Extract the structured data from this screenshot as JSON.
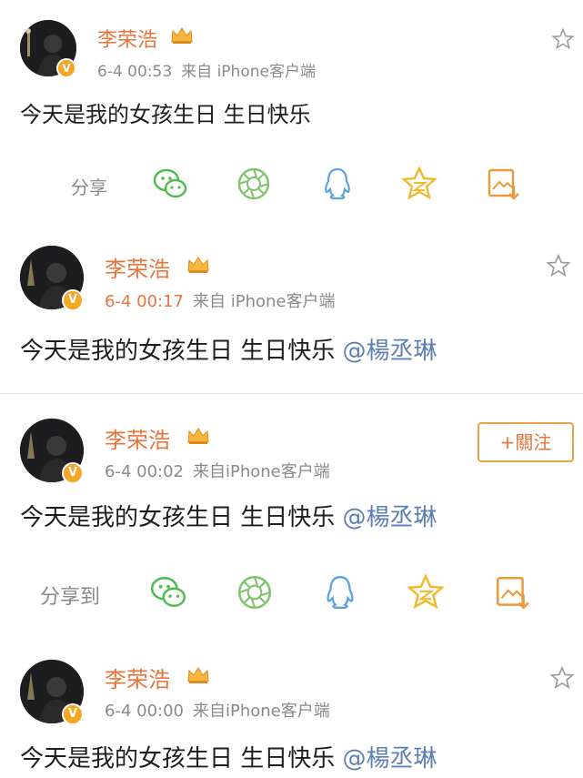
{
  "share_icons": [
    "wechat-icon",
    "moments-icon",
    "qq-icon",
    "qzone-icon",
    "save-image-icon"
  ],
  "colors": {
    "name": "#e8743b",
    "meta": "#8a8a8a",
    "mention": "#5b7fb4",
    "wechat": "#4cbc4c",
    "moments": "#7fc36a",
    "qq": "#5ba2e0",
    "qzone": "#f1b92c",
    "save": "#e99a3a"
  },
  "posts": [
    {
      "user": "李荣浩",
      "avatar_badge": "V",
      "time": "6-4 00:53",
      "source": "来自 iPhone客户端",
      "text": "今天是我的女孩生日 生日快乐",
      "mention": "",
      "share_label": "分享"
    },
    {
      "user": "李荣浩",
      "avatar_badge": "V",
      "time": "6-4 00:17",
      "source": "来自 iPhone客户端",
      "text": "今天是我的女孩生日 生日快乐",
      "mention": "@楊丞琳"
    },
    {
      "user": "李荣浩",
      "avatar_badge": "V",
      "time": "6-4 00:02",
      "source": "来自iPhone客户端",
      "text": "今天是我的女孩生日 生日快乐",
      "mention": "@楊丞琳",
      "follow_label": "+關注",
      "share_label": "分享到"
    },
    {
      "user": "李荣浩",
      "avatar_badge": "V",
      "time": "6-4 00:00",
      "source": "来自iPhone客户端",
      "text": "今天是我的女孩生日 生日快乐",
      "mention": "@楊丞琳"
    }
  ]
}
